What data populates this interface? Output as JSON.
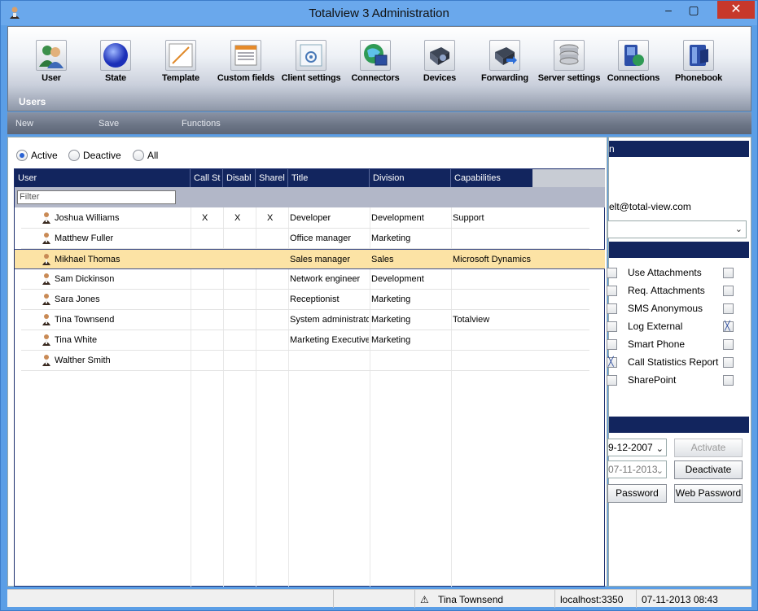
{
  "window": {
    "title": "Totalview 3  Administration",
    "close_glyph": "✕",
    "min_glyph": "–",
    "max_glyph": "▢"
  },
  "ribbon": {
    "buttons": [
      {
        "label": "User",
        "icon": "user-icon"
      },
      {
        "label": "State",
        "icon": "state-icon"
      },
      {
        "label": "Template",
        "icon": "template-icon"
      },
      {
        "label": "Custom fields",
        "icon": "custom-fields-icon"
      },
      {
        "label": "Client settings",
        "icon": "client-settings-icon"
      },
      {
        "label": "Connectors",
        "icon": "connectors-icon"
      },
      {
        "label": "Devices",
        "icon": "devices-icon"
      },
      {
        "label": "Forwarding",
        "icon": "forwarding-icon"
      },
      {
        "label": "Server settings",
        "icon": "server-settings-icon"
      },
      {
        "label": "Connections",
        "icon": "connections-icon"
      },
      {
        "label": "Phonebook",
        "icon": "phonebook-icon"
      }
    ],
    "section": "Users"
  },
  "menubar": {
    "new": "New",
    "save": "Save",
    "functions": "Functions"
  },
  "filter_radios": {
    "active": "Active",
    "deactive": "Deactive",
    "all": "All",
    "selected": "active"
  },
  "grid": {
    "columns": [
      "User",
      "Call St",
      "Disabl",
      "Sharel",
      "Title",
      "Division",
      "Capabilities"
    ],
    "filter_placeholder": "Filter",
    "rows": [
      {
        "user": "Joshua Williams",
        "call": "X",
        "disabled": "X",
        "shared": "X",
        "title": "Developer",
        "division": "Development",
        "capabilities": "Support"
      },
      {
        "user": "Matthew Fuller",
        "call": "",
        "disabled": "",
        "shared": "",
        "title": "Office manager",
        "division": "Marketing",
        "capabilities": ""
      },
      {
        "user": "Mikhael Thomas",
        "call": "",
        "disabled": "",
        "shared": "",
        "title": "Sales manager",
        "division": "Sales",
        "capabilities": "Microsoft Dynamics"
      },
      {
        "user": "Sam Dickinson",
        "call": "",
        "disabled": "",
        "shared": "",
        "title": "Network engineer",
        "division": "Development",
        "capabilities": ""
      },
      {
        "user": "Sara Jones",
        "call": "",
        "disabled": "",
        "shared": "",
        "title": "Receptionist",
        "division": "Marketing",
        "capabilities": ""
      },
      {
        "user": "Tina Townsend",
        "call": "",
        "disabled": "",
        "shared": "",
        "title": "System administrator",
        "division": "Marketing",
        "capabilities": "Totalview"
      },
      {
        "user": "Tina White",
        "call": "",
        "disabled": "",
        "shared": "",
        "title": "Marketing Executive",
        "division": "Marketing",
        "capabilities": ""
      },
      {
        "user": "Walther Smith",
        "call": "",
        "disabled": "",
        "shared": "",
        "title": "",
        "division": "",
        "capabilities": ""
      }
    ],
    "selected_row": 2
  },
  "details": {
    "header1": "n",
    "email": "elt@total-view.com",
    "options": [
      {
        "label": "Use Attachments",
        "left_checked": false,
        "right_checked": false
      },
      {
        "label": "Req. Attachments",
        "left_checked": false,
        "right_checked": false
      },
      {
        "label": "SMS Anonymous",
        "left_checked": false,
        "right_checked": false
      },
      {
        "label": "Log External",
        "left_checked": false,
        "right_checked": true
      },
      {
        "label": "Smart Phone",
        "left_checked": false,
        "right_checked": false
      },
      {
        "label": "Call Statistics Report",
        "left_checked": true,
        "right_checked": false
      },
      {
        "label": "SharePoint",
        "left_checked": false,
        "right_checked": false
      }
    ],
    "date1": "9-12-2007",
    "date2": "07-11-2013",
    "activate_label": "Activate",
    "deactivate_label": "Deactivate",
    "password_label": "Password",
    "web_password_label": "Web Password"
  },
  "statusbar": {
    "user": "Tina Townsend",
    "server": "localhost:3350",
    "datetime": "07-11-2013 08:43",
    "warning_glyph": "⚠"
  }
}
